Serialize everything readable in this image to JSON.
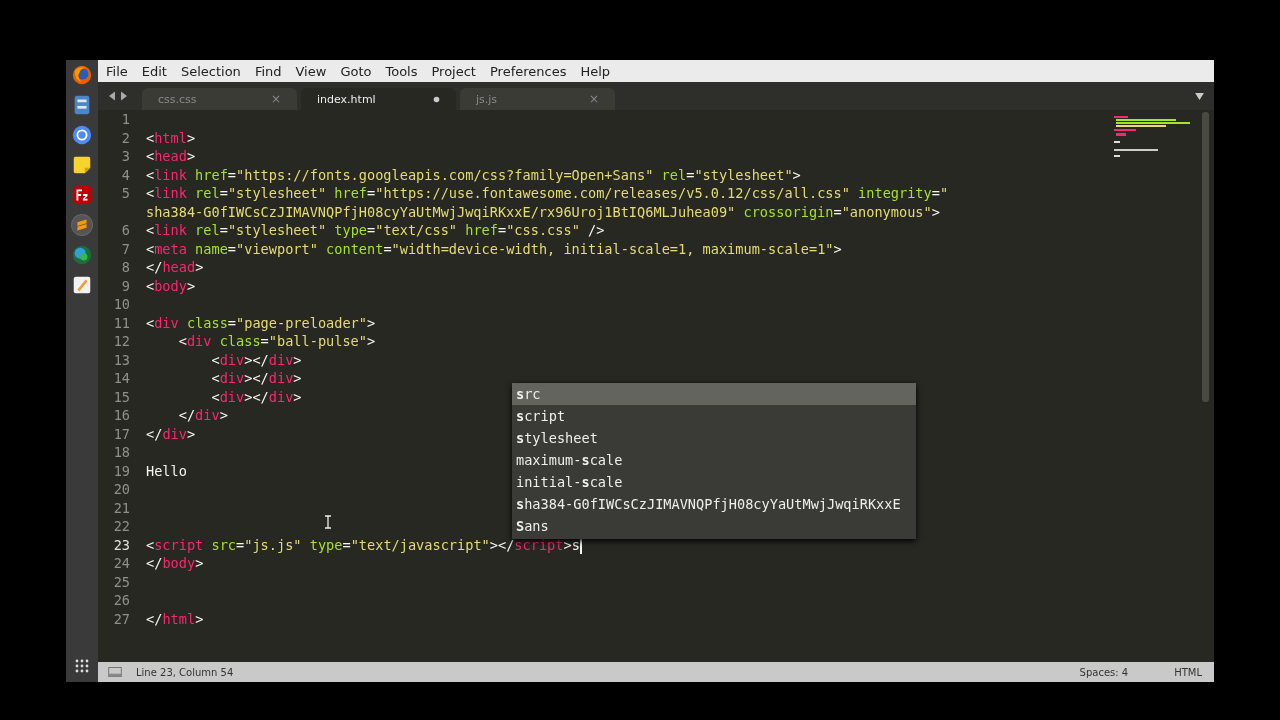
{
  "menu": [
    {
      "label": "File"
    },
    {
      "label": "Edit"
    },
    {
      "label": "Selection"
    },
    {
      "label": "Find"
    },
    {
      "label": "View"
    },
    {
      "label": "Goto"
    },
    {
      "label": "Tools"
    },
    {
      "label": "Project"
    },
    {
      "label": "Preferences"
    },
    {
      "label": "Help"
    }
  ],
  "tabs": [
    {
      "label": "css.css",
      "selected": false,
      "modified": false,
      "close": "×"
    },
    {
      "label": "index.html",
      "selected": true,
      "modified": true
    },
    {
      "label": "js.js",
      "selected": false,
      "modified": false,
      "close": "×"
    }
  ],
  "rows": [
    {
      "number": "1",
      "current": false
    },
    {
      "number": "2",
      "current": false,
      "tokens": [
        {
          "kind": "p",
          "text": "<"
        },
        {
          "kind": "tag",
          "text": "html"
        },
        {
          "kind": "p",
          "text": ">"
        }
      ]
    },
    {
      "number": "3",
      "current": false,
      "tokens": [
        {
          "kind": "p",
          "text": "<"
        },
        {
          "kind": "tag",
          "text": "head"
        },
        {
          "kind": "p",
          "text": ">"
        }
      ]
    },
    {
      "number": "4",
      "current": false,
      "tokens": [
        {
          "kind": "p",
          "text": "<"
        },
        {
          "kind": "tag",
          "text": "link"
        },
        {
          "kind": "attr",
          "text": " href"
        },
        {
          "kind": "p",
          "text": "="
        },
        {
          "kind": "str",
          "text": "\"https://fonts.googleapis.com/css?family=Open+Sans\""
        },
        {
          "kind": "attr",
          "text": " rel"
        },
        {
          "kind": "p",
          "text": "="
        },
        {
          "kind": "str",
          "text": "\"stylesheet\""
        },
        {
          "kind": "p",
          "text": ">"
        }
      ]
    },
    {
      "number": "5",
      "current": false,
      "tokens": [
        {
          "kind": "p",
          "text": "<"
        },
        {
          "kind": "tag",
          "text": "link"
        },
        {
          "kind": "attr",
          "text": " rel"
        },
        {
          "kind": "p",
          "text": "="
        },
        {
          "kind": "str",
          "text": "\"stylesheet\""
        },
        {
          "kind": "attr",
          "text": " href"
        },
        {
          "kind": "p",
          "text": "="
        },
        {
          "kind": "str",
          "text": "\"https://use.fontawesome.com/releases/v5.0.12/css/all.css\""
        },
        {
          "kind": "attr",
          "text": " integrity"
        },
        {
          "kind": "p",
          "text": "="
        },
        {
          "kind": "str",
          "text": "\""
        }
      ]
    },
    {
      "tokens": [
        {
          "kind": "str",
          "text": "sha384-G0fIWCsCzJIMAVNQPfjH08cyYaUtMwjJwqiRKxxE/rx96Uroj1BtIQ6MLJuhea09\""
        },
        {
          "kind": "attr",
          "text": " crossorigin"
        },
        {
          "kind": "p",
          "text": "="
        },
        {
          "kind": "str",
          "text": "\"anonymous\""
        },
        {
          "kind": "p",
          "text": ">"
        }
      ]
    },
    {
      "number": "6",
      "current": false,
      "tokens": [
        {
          "kind": "p",
          "text": "<"
        },
        {
          "kind": "tag",
          "text": "link"
        },
        {
          "kind": "attr",
          "text": " rel"
        },
        {
          "kind": "p",
          "text": "="
        },
        {
          "kind": "str",
          "text": "\"stylesheet\""
        },
        {
          "kind": "attr",
          "text": " type"
        },
        {
          "kind": "p",
          "text": "="
        },
        {
          "kind": "str",
          "text": "\"text/css\""
        },
        {
          "kind": "attr",
          "text": " href"
        },
        {
          "kind": "p",
          "text": "="
        },
        {
          "kind": "str",
          "text": "\"css.css\""
        },
        {
          "kind": "p",
          "text": " />"
        }
      ]
    },
    {
      "number": "7",
      "current": false,
      "tokens": [
        {
          "kind": "p",
          "text": "<"
        },
        {
          "kind": "tag",
          "text": "meta"
        },
        {
          "kind": "attr",
          "text": " name"
        },
        {
          "kind": "p",
          "text": "="
        },
        {
          "kind": "str",
          "text": "\"viewport\""
        },
        {
          "kind": "attr",
          "text": " content"
        },
        {
          "kind": "p",
          "text": "="
        },
        {
          "kind": "str",
          "text": "\"width=device-width, initial-scale=1, maximum-scale=1\""
        },
        {
          "kind": "p",
          "text": ">"
        }
      ]
    },
    {
      "number": "8",
      "current": false,
      "tokens": [
        {
          "kind": "p",
          "text": "</"
        },
        {
          "kind": "tag",
          "text": "head"
        },
        {
          "kind": "p",
          "text": ">"
        }
      ]
    },
    {
      "number": "9",
      "current": false,
      "tokens": [
        {
          "kind": "p",
          "text": "<"
        },
        {
          "kind": "tag",
          "text": "body"
        },
        {
          "kind": "p",
          "text": ">"
        }
      ]
    },
    {
      "number": "10",
      "current": false
    },
    {
      "number": "11",
      "current": false,
      "tokens": [
        {
          "kind": "p",
          "text": "<"
        },
        {
          "kind": "tag",
          "text": "div"
        },
        {
          "kind": "attr",
          "text": " class"
        },
        {
          "kind": "p",
          "text": "="
        },
        {
          "kind": "str",
          "text": "\"page-preloader\""
        },
        {
          "kind": "p",
          "text": ">"
        }
      ]
    },
    {
      "number": "12",
      "current": false,
      "tokens": [
        {
          "kind": "p",
          "text": "    <"
        },
        {
          "kind": "tag",
          "text": "div"
        },
        {
          "kind": "attr",
          "text": " class"
        },
        {
          "kind": "p",
          "text": "="
        },
        {
          "kind": "str",
          "text": "\"ball-pulse\""
        },
        {
          "kind": "p",
          "text": ">"
        }
      ]
    },
    {
      "number": "13",
      "current": false,
      "tokens": [
        {
          "kind": "p",
          "text": "        <"
        },
        {
          "kind": "tag",
          "text": "div"
        },
        {
          "kind": "p",
          "text": "></"
        },
        {
          "kind": "tag",
          "text": "div"
        },
        {
          "kind": "p",
          "text": ">"
        }
      ]
    },
    {
      "number": "14",
      "current": false,
      "tokens": [
        {
          "kind": "p",
          "text": "        <"
        },
        {
          "kind": "tag",
          "text": "div"
        },
        {
          "kind": "p",
          "text": "></"
        },
        {
          "kind": "tag",
          "text": "div"
        },
        {
          "kind": "p",
          "text": ">"
        }
      ]
    },
    {
      "number": "15",
      "current": false,
      "tokens": [
        {
          "kind": "p",
          "text": "        <"
        },
        {
          "kind": "tag",
          "text": "div"
        },
        {
          "kind": "p",
          "text": "></"
        },
        {
          "kind": "tag",
          "text": "div"
        },
        {
          "kind": "p",
          "text": ">"
        }
      ]
    },
    {
      "number": "16",
      "current": false,
      "tokens": [
        {
          "kind": "p",
          "text": "    </"
        },
        {
          "kind": "tag",
          "text": "div"
        },
        {
          "kind": "p",
          "text": ">"
        }
      ]
    },
    {
      "number": "17",
      "current": false,
      "tokens": [
        {
          "kind": "p",
          "text": "</"
        },
        {
          "kind": "tag",
          "text": "div"
        },
        {
          "kind": "p",
          "text": ">"
        }
      ]
    },
    {
      "number": "18",
      "current": false
    },
    {
      "number": "19",
      "current": false,
      "tokens": [
        {
          "kind": "p",
          "text": "Hello"
        }
      ]
    },
    {
      "number": "20",
      "current": false
    },
    {
      "number": "21",
      "current": false
    },
    {
      "number": "22",
      "current": false
    },
    {
      "number": "23",
      "current": true,
      "tokens": [
        {
          "kind": "p",
          "text": "<"
        },
        {
          "kind": "tag",
          "text": "script"
        },
        {
          "kind": "attr",
          "text": " src"
        },
        {
          "kind": "p",
          "text": "="
        },
        {
          "kind": "str",
          "text": "\"js.js\""
        },
        {
          "kind": "attr",
          "text": " type"
        },
        {
          "kind": "p",
          "text": "="
        },
        {
          "kind": "str",
          "text": "\"text/javascript\""
        },
        {
          "kind": "p",
          "text": "></"
        },
        {
          "kind": "tag",
          "text": "script"
        },
        {
          "kind": "p",
          "text": ">s"
        }
      ]
    },
    {
      "number": "24",
      "current": false,
      "tokens": [
        {
          "kind": "p",
          "text": "</"
        },
        {
          "kind": "tag",
          "text": "body"
        },
        {
          "kind": "p",
          "text": ">"
        }
      ]
    },
    {
      "number": "25",
      "current": false
    },
    {
      "number": "26",
      "current": false
    },
    {
      "number": "27",
      "current": false,
      "tokens": [
        {
          "kind": "p",
          "text": "</"
        },
        {
          "kind": "tag",
          "text": "html"
        },
        {
          "kind": "p",
          "text": ">"
        }
      ]
    }
  ],
  "completions": [
    {
      "label": "**s**rc",
      "selected": true
    },
    {
      "label": "**s**cript",
      "selected": false
    },
    {
      "label": "**s**tylesheet",
      "selected": false
    },
    {
      "label": "maximum-**s**cale",
      "selected": false
    },
    {
      "label": "initial-**s**cale",
      "selected": false
    },
    {
      "label": "**s**ha384-G0fIWCsCzJIMAVNQPfjH08cyYaUtMwjJwqiRKxxE",
      "selected": false
    },
    {
      "label": "**S**ans",
      "selected": false
    }
  ],
  "status_bar": {
    "position": "Line 23, Column 54",
    "indentation": "Spaces: 4",
    "syntax": "HTML"
  }
}
